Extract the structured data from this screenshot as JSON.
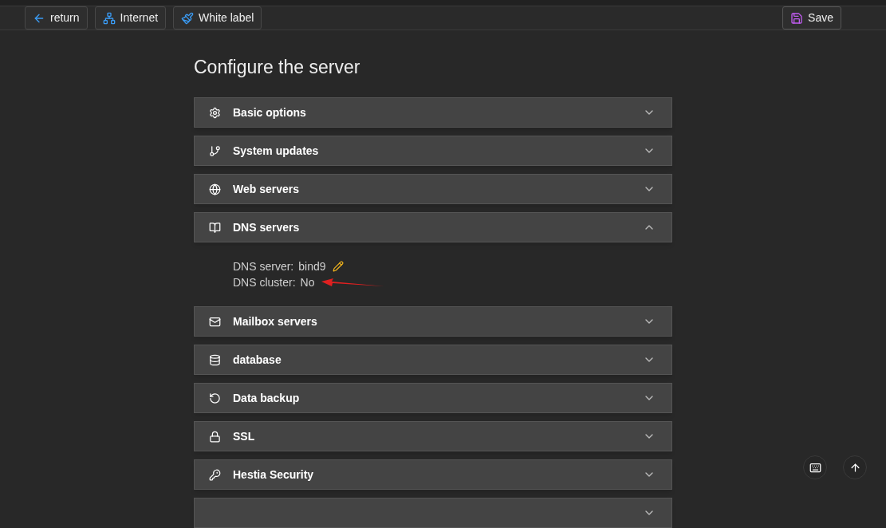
{
  "toolbar": {
    "left_buttons": [
      "return",
      "Internet",
      "White label"
    ],
    "save_button": "Save"
  },
  "page_title": "Configure the server",
  "sections": [
    {
      "title": "Basic options",
      "expanded": false
    },
    {
      "title": "System updates",
      "expanded": false
    },
    {
      "title": "Web servers",
      "expanded": false
    },
    {
      "title": "DNS servers",
      "expanded": true,
      "details": [
        {
          "label": "DNS server:",
          "value": "bind9",
          "editable": true
        },
        {
          "label": "DNS cluster:",
          "value": "No",
          "editable": false,
          "annotated": true
        }
      ]
    },
    {
      "title": "Mailbox servers",
      "expanded": false
    },
    {
      "title": "database",
      "expanded": false
    },
    {
      "title": "Data backup",
      "expanded": false
    },
    {
      "title": "SSL",
      "expanded": false
    },
    {
      "title": "Hestia Security",
      "expanded": false
    },
    {
      "expanded": false
    }
  ]
}
